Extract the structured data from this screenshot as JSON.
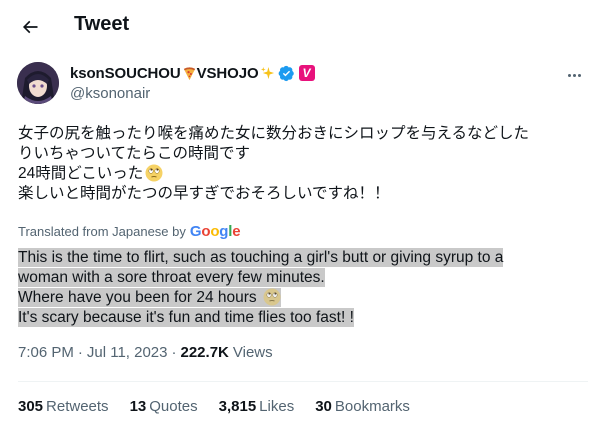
{
  "header": {
    "title": "Tweet",
    "back_icon": "arrow-left-icon"
  },
  "author": {
    "display_name": "ksonSOUCHOU",
    "handle": "@ksononair",
    "name_suffix": "VSHOJO",
    "badge_letter": "V",
    "badge_color": "#e8127c",
    "verified_color": "#1d9bf0"
  },
  "tweet": {
    "lines": [
      "女子の尻を触ったり喉を痛めた女に数分おきにシロップを与えるなどした",
      "りいちゃついてたらこの時間です",
      "24時間どこいった",
      "楽しいと時間がたつの早すぎでおそろしいですね！！"
    ]
  },
  "translation": {
    "label": "Translated from Japanese by",
    "provider": "Google",
    "lines": [
      "This is the time to flirt, such as touching a girl's butt or giving syrup to a",
      "woman with a sore throat every few minutes.",
      "Where have you been for 24 hours",
      "It's scary because it's fun and time flies too fast! !"
    ],
    "highlight_color": "#c9c9c9"
  },
  "meta": {
    "time": "7:06 PM",
    "date": "Jul 11, 2023",
    "views_count": "222.7K",
    "views_label": "Views"
  },
  "stats": {
    "retweets_count": "305",
    "retweets_label": "Retweets",
    "quotes_count": "13",
    "quotes_label": "Quotes",
    "likes_count": "3,815",
    "likes_label": "Likes",
    "bookmarks_count": "30",
    "bookmarks_label": "Bookmarks"
  }
}
